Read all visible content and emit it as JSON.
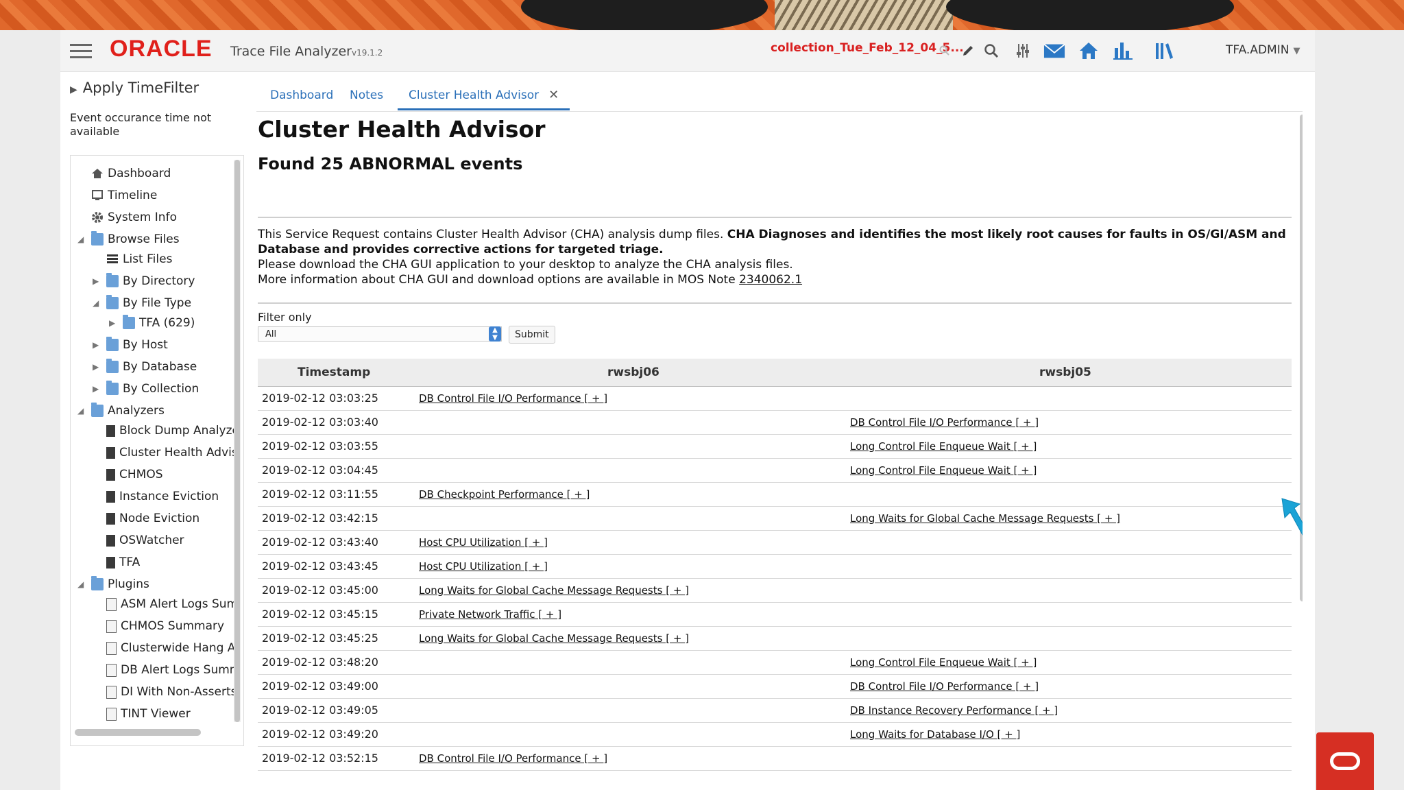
{
  "colors": {
    "accent": "#2a6fb8",
    "brand": "#e0201b",
    "collection": "#d92121"
  },
  "header": {
    "logo": "ORACLE",
    "product": "Trace File Analyzer",
    "version": "v19.1.2",
    "collection": "collection_Tue_Feb_12_04_5...",
    "user": "TFA.ADMIN",
    "icons": [
      "search-icon",
      "pencil-icon",
      "magnifier-icon",
      "sliders-icon",
      "mail-icon",
      "home-icon",
      "bar-chart-icon",
      "library-icon"
    ]
  },
  "sidebar": {
    "timefilter_title": "Apply TimeFilter",
    "timefilter_note": "Event occurance time not available",
    "nav": [
      {
        "label": "Dashboard",
        "icon": "home-icon"
      },
      {
        "label": "Timeline",
        "icon": "monitor-icon"
      },
      {
        "label": "System Info",
        "icon": "gear-icon"
      },
      {
        "label": "Browse Files",
        "icon": "folder-icon"
      },
      {
        "label": "List Files",
        "icon": "list-icon"
      },
      {
        "label": "By Directory",
        "icon": "folder-icon"
      },
      {
        "label": "By File Type",
        "icon": "folder-icon"
      },
      {
        "label": "TFA (629)",
        "icon": "folder-icon"
      },
      {
        "label": "By Host",
        "icon": "folder-icon"
      },
      {
        "label": "By Database",
        "icon": "folder-icon"
      },
      {
        "label": "By Collection",
        "icon": "folder-icon"
      },
      {
        "label": "Analyzers",
        "icon": "folder-icon"
      },
      {
        "label": "Block Dump Analyze",
        "icon": "report-icon"
      },
      {
        "label": "Cluster Health Advis",
        "icon": "report-icon"
      },
      {
        "label": "CHMOS",
        "icon": "report-icon"
      },
      {
        "label": "Instance Eviction",
        "icon": "report-icon"
      },
      {
        "label": "Node Eviction",
        "icon": "report-icon"
      },
      {
        "label": "OSWatcher",
        "icon": "report-icon"
      },
      {
        "label": "TFA",
        "icon": "report-icon"
      },
      {
        "label": "Plugins",
        "icon": "folder-icon"
      },
      {
        "label": "ASM Alert Logs Sum",
        "icon": "document-icon"
      },
      {
        "label": "CHMOS Summary",
        "icon": "document-icon"
      },
      {
        "label": "Clusterwide Hang Ar",
        "icon": "document-icon"
      },
      {
        "label": "DB Alert Logs Summ",
        "icon": "document-icon"
      },
      {
        "label": "DI With Non-Asserts",
        "icon": "document-icon"
      },
      {
        "label": "TINT Viewer",
        "icon": "document-icon"
      }
    ]
  },
  "tabs": [
    "Dashboard",
    "Notes",
    "Cluster Health Advisor"
  ],
  "main": {
    "title": "Cluster Health Advisor",
    "subtitle": "Found 25 ABNORMAL events",
    "desc_intro": "This Service Request contains Cluster Health Advisor (CHA) analysis dump files. ",
    "desc_bold": "CHA Diagnoses and identifies the most likely root causes for faults in OS/GI/ASM and Database and provides corrective actions for targeted triage.",
    "desc_line2": "Please download the CHA GUI application to your desktop to analyze the CHA analysis files.",
    "desc_line3": "More information about CHA GUI and download options are available in MOS Note ",
    "mos_note": "2340062.1",
    "filter_label": "Filter only",
    "filter_value": "All",
    "submit": "Submit"
  },
  "table": {
    "headers": [
      "Timestamp",
      "rwsbj06",
      "rwsbj05"
    ],
    "rows": [
      {
        "ts": "2019-02-12 03:03:25",
        "c1": "DB Control File I/O Performance [ + ]",
        "c2": ""
      },
      {
        "ts": "2019-02-12 03:03:40",
        "c1": "",
        "c2": "DB Control File I/O Performance [ + ]"
      },
      {
        "ts": "2019-02-12 03:03:55",
        "c1": "",
        "c2": "Long Control File Enqueue Wait [ + ]"
      },
      {
        "ts": "2019-02-12 03:04:45",
        "c1": "",
        "c2": "Long Control File Enqueue Wait [ + ]"
      },
      {
        "ts": "2019-02-12 03:11:55",
        "c1": "DB Checkpoint Performance [ + ]",
        "c2": ""
      },
      {
        "ts": "2019-02-12 03:42:15",
        "c1": "",
        "c2": "Long Waits for Global Cache Message Requests [ + ]"
      },
      {
        "ts": "2019-02-12 03:43:40",
        "c1": "Host CPU Utilization [ + ]",
        "c2": ""
      },
      {
        "ts": "2019-02-12 03:43:45",
        "c1": "Host CPU Utilization [ + ]",
        "c2": ""
      },
      {
        "ts": "2019-02-12 03:45:00",
        "c1": "Long Waits for Global Cache Message Requests [ + ]",
        "c2": ""
      },
      {
        "ts": "2019-02-12 03:45:15",
        "c1": "Private Network Traffic [ + ]",
        "c2": ""
      },
      {
        "ts": "2019-02-12 03:45:25",
        "c1": "Long Waits for Global Cache Message Requests [ + ]",
        "c2": ""
      },
      {
        "ts": "2019-02-12 03:48:20",
        "c1": "",
        "c2": "Long Control File Enqueue Wait [ + ]"
      },
      {
        "ts": "2019-02-12 03:49:00",
        "c1": "",
        "c2": "DB Control File I/O Performance [ + ]"
      },
      {
        "ts": "2019-02-12 03:49:05",
        "c1": "",
        "c2": "DB Instance Recovery Performance [ + ]"
      },
      {
        "ts": "2019-02-12 03:49:20",
        "c1": "",
        "c2": "Long Waits for Database I/O [ + ]"
      },
      {
        "ts": "2019-02-12 03:52:15",
        "c1": "DB Control File I/O Performance [ + ]",
        "c2": ""
      }
    ]
  }
}
